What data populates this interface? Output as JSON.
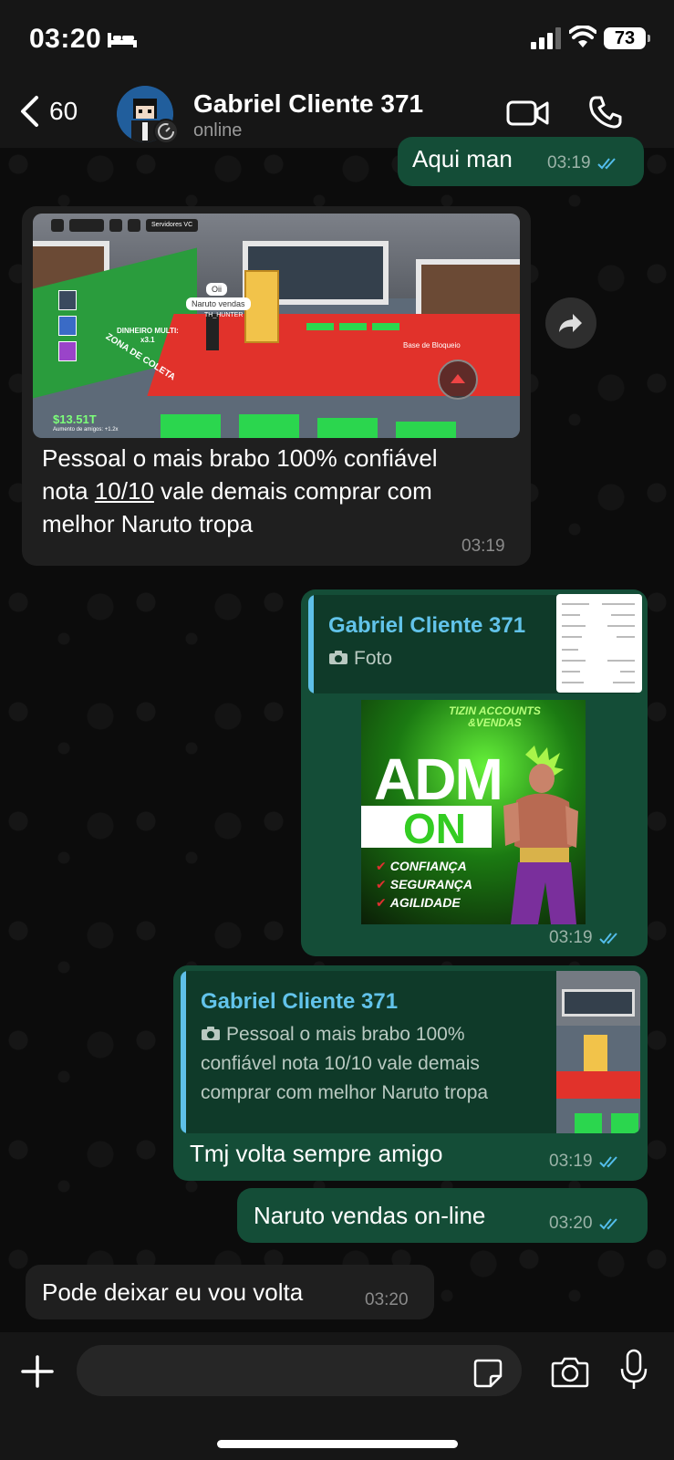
{
  "status_bar": {
    "time": "03:20",
    "battery": "73"
  },
  "header": {
    "back_count": "60",
    "contact_name": "Gabriel Cliente 371",
    "contact_status": "online"
  },
  "messages": {
    "m0": {
      "text": "Aqui man",
      "time": "03:19"
    },
    "m1": {
      "caption": "Pessoal o mais brabo 100% confiável nota 10/10 vale demais comprar com melhor Naruto tropa",
      "caption_pre": "Pessoal o mais brabo 100% confiável",
      "caption_link": "10/10",
      "caption_l2_pre": "nota ",
      "caption_l2_post": " vale demais comprar com",
      "caption_l3": "melhor Naruto tropa",
      "time": "03:19",
      "game": {
        "money": "$13.51T",
        "money_sub": "Aumento de amigos: +1.2x",
        "dinheiro": "DINHEIRO MULTI:",
        "mult": "x3.1",
        "chat1": "Oii",
        "chat2": "Naruto vendas",
        "player": "TH_HUNTER",
        "base": "Base de Bloqueio",
        "servers": "Servidores VC",
        "zone": "ZONA DE COLETA"
      }
    },
    "m2": {
      "quote_name": "Gabriel Cliente 371",
      "quote_type": "Foto",
      "time": "03:19",
      "poster": {
        "brand": "TIZIN ACCOUNTS",
        "brand2": "&VENDAS",
        "adm": "ADM",
        "on": "ON",
        "items": [
          "CONFIANÇA",
          "SEGURANÇA",
          "AGILIDADE"
        ]
      }
    },
    "m3": {
      "quote_name": "Gabriel Cliente 371",
      "quote_l1": "Pessoal o mais brabo 100%",
      "quote_l2": "confiável nota 10/10 vale demais",
      "quote_l3": "comprar com melhor Naruto tropa",
      "text": "Tmj volta sempre amigo",
      "time": "03:19"
    },
    "m4": {
      "text": "Naruto vendas on-line",
      "time": "03:20"
    },
    "m5": {
      "text": "Pode deixar eu vou volta",
      "time": "03:20"
    }
  },
  "input": {
    "placeholder": ""
  },
  "colors": {
    "outgoing": "#144d37",
    "incoming": "#1f1f1f",
    "quote_accent": "#62c3ea",
    "ticks": "#53bdeb"
  }
}
